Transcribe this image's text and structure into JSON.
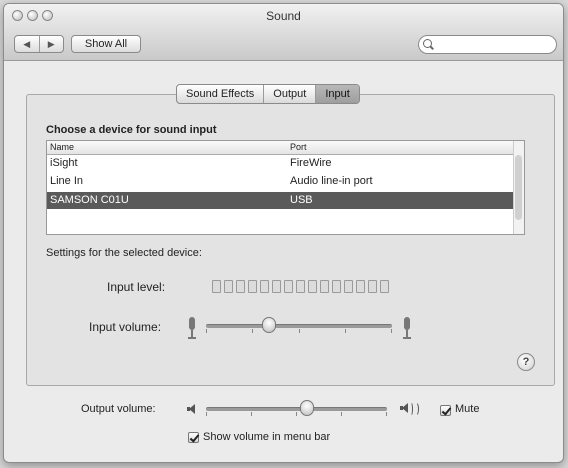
{
  "window": {
    "title": "Sound"
  },
  "toolbar": {
    "back_label": "◀",
    "forward_label": "▶",
    "show_all_label": "Show All",
    "search_value": ""
  },
  "tabs": [
    {
      "label": "Sound Effects",
      "active": false
    },
    {
      "label": "Output",
      "active": false
    },
    {
      "label": "Input",
      "active": true
    }
  ],
  "input": {
    "choose_label": "Choose a device for sound input",
    "columns": {
      "name": "Name",
      "port": "Port"
    },
    "devices": [
      {
        "name": "iSight",
        "port": "FireWire",
        "selected": false
      },
      {
        "name": "Line In",
        "port": "Audio line-in port",
        "selected": false
      },
      {
        "name": "SAMSON C01U",
        "port": "USB",
        "selected": true
      }
    ],
    "settings_label": "Settings for the selected device:",
    "input_level_label": "Input level:",
    "input_level_segments": 15,
    "input_level_active": 0,
    "input_volume_label": "Input volume:",
    "input_volume_fraction": 0.34
  },
  "help": {
    "label": "?"
  },
  "output": {
    "volume_label": "Output volume:",
    "volume_fraction": 0.56,
    "mute_label": "Mute",
    "mute_checked": true,
    "menu_bar_label": "Show volume in menu bar",
    "menu_bar_checked": true
  },
  "colors": {
    "selected_row": "#5a5a5a",
    "window_bg": "#ebebeb"
  }
}
